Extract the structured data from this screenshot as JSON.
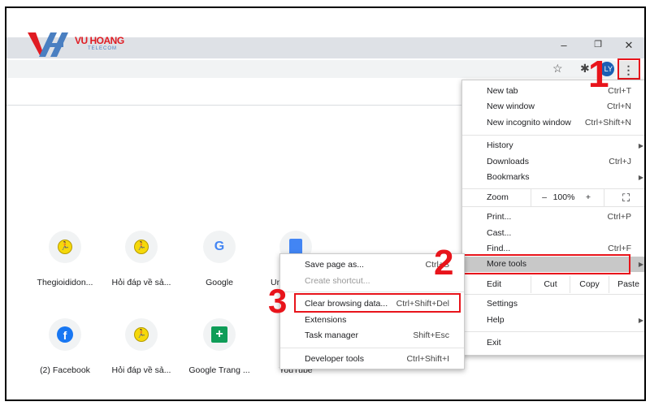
{
  "logo": {
    "brand": "VU HOANG",
    "sub": "TELECOM"
  },
  "window_controls": {
    "minimize": "–",
    "restore": "❐",
    "close": "✕"
  },
  "toolbar": {
    "star_icon": "☆",
    "extensions_icon": "✱",
    "profile": "LY",
    "menu_icon": "⋮"
  },
  "shortcuts": [
    {
      "label": "Thegioididon...",
      "icon": "runner"
    },
    {
      "label": "Hỏi đáp về sả...",
      "icon": "runner"
    },
    {
      "label": "Google",
      "icon": "G"
    },
    {
      "label": "Unt...",
      "icon": "docs"
    },
    {
      "label": "(2) Facebook",
      "icon": "f"
    },
    {
      "label": "Hỏi đáp về sả...",
      "icon": "runner"
    },
    {
      "label": "Google Trang ...",
      "icon": "+"
    },
    {
      "label": "YouTube",
      "icon": "youtube"
    }
  ],
  "main_menu": {
    "new_tab": {
      "label": "New tab",
      "shortcut": "Ctrl+T"
    },
    "new_window": {
      "label": "New window",
      "shortcut": "Ctrl+N"
    },
    "incognito": {
      "label": "New incognito window",
      "shortcut": "Ctrl+Shift+N"
    },
    "history": {
      "label": "History"
    },
    "downloads": {
      "label": "Downloads",
      "shortcut": "Ctrl+J"
    },
    "bookmarks": {
      "label": "Bookmarks"
    },
    "zoom": {
      "label": "Zoom",
      "minus": "–",
      "value": "100%",
      "plus": "+",
      "fullscreen": "⛶"
    },
    "print": {
      "label": "Print...",
      "shortcut": "Ctrl+P"
    },
    "cast": {
      "label": "Cast..."
    },
    "find": {
      "label": "Find...",
      "shortcut": "Ctrl+F"
    },
    "more_tools": {
      "label": "More tools"
    },
    "edit": {
      "label": "Edit",
      "cut": "Cut",
      "copy": "Copy",
      "paste": "Paste"
    },
    "settings": {
      "label": "Settings"
    },
    "help": {
      "label": "Help"
    },
    "exit": {
      "label": "Exit"
    }
  },
  "sub_menu": {
    "save_page": {
      "label": "Save page as...",
      "shortcut": "Ctrl+S"
    },
    "create_shortcut": {
      "label": "Create shortcut..."
    },
    "clear_data": {
      "label": "Clear browsing data...",
      "shortcut": "Ctrl+Shift+Del"
    },
    "extensions": {
      "label": "Extensions"
    },
    "task_manager": {
      "label": "Task manager",
      "shortcut": "Shift+Esc"
    },
    "dev_tools": {
      "label": "Developer tools",
      "shortcut": "Ctrl+Shift+I"
    }
  },
  "steps": [
    "1",
    "2",
    "3"
  ],
  "colors": {
    "annotation": "#e8141b",
    "tabbar": "#dee1e6",
    "highlight": "#c8c8c8"
  }
}
